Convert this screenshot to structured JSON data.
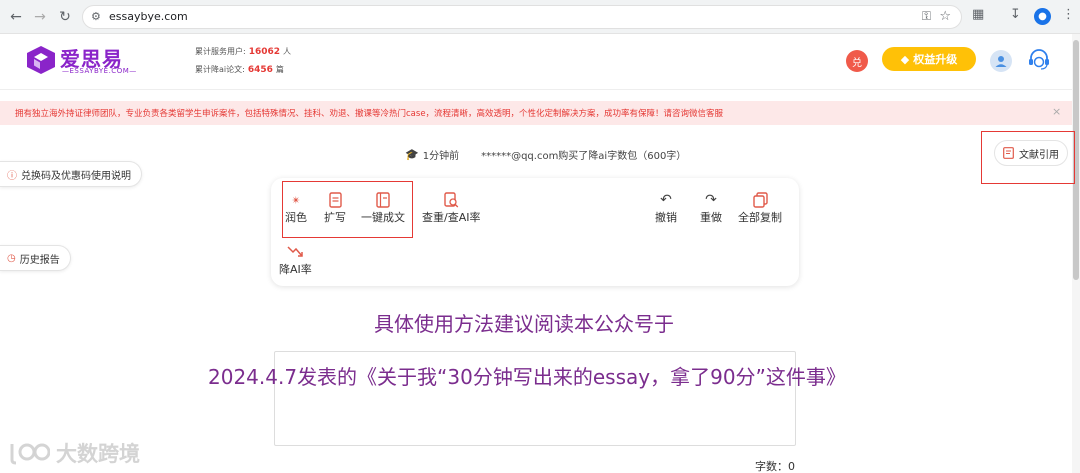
{
  "browser": {
    "url": "essaybye.com"
  },
  "header": {
    "logo_title": "爱思易",
    "logo_subtitle": "—ESSAYBYE.COM—",
    "stats": [
      {
        "label": "累计服务用户:",
        "value": "16062",
        "unit": "人"
      },
      {
        "label": "累计降ai论文:",
        "value": "6456",
        "unit": "篇"
      }
    ],
    "redeem_badge": "兑",
    "upgrade_label": "权益升级"
  },
  "notice": {
    "text": "拥有独立海外持证律师团队，专业负责各类留学生申诉案件，包括特殊情况、挂科、劝退、撤课等冷热门case，流程清晰，高效透明，个性化定制解决方案，成功率有保障！请咨询微信客服",
    "close": "×"
  },
  "side": {
    "redeem_help": "兑换码及优惠码使用说明",
    "history": "历史报告"
  },
  "purchase": {
    "time": "1分钟前",
    "message": "******@qq.com购买了降ai字数包（600字）"
  },
  "reference_button": "文献引用",
  "toolbar": {
    "polish": "润色",
    "expand": "扩写",
    "one_click": "一键成文",
    "check": "查重/查AI率",
    "undo": "撤销",
    "redo": "重做",
    "copy_all": "全部复制",
    "reduce_ai": "降AI率"
  },
  "overlay": {
    "line1": "具体使用方法建议阅读本公众号于",
    "line2": "2024.4.7发表的《关于我“30分钟写出来的essay，拿了90分”这件事》"
  },
  "word_count": "字数：0",
  "watermark": "大数跨境",
  "colors": {
    "brand_purple": "#8a24c9",
    "alert_red": "#e53935",
    "upgrade_yellow": "#ffc107",
    "overlay_purple": "#7b2d8e"
  }
}
